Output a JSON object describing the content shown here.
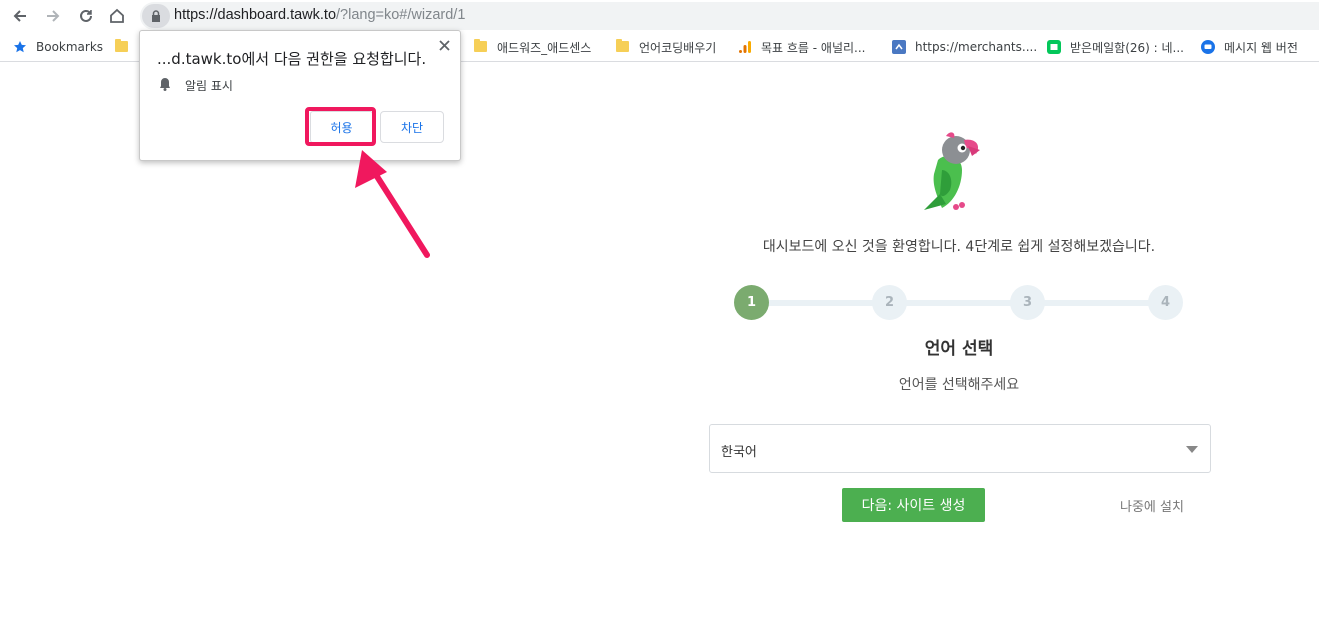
{
  "browser": {
    "url_host": "https://dashboard.tawk.to",
    "url_path": "/?lang=ko#/wizard/1",
    "bookmarks": [
      {
        "label": "Bookmarks",
        "icon": "star-icon"
      },
      {
        "label": "애드워즈_애드센스",
        "icon": "folder-icon"
      },
      {
        "label": "언어코딩배우기",
        "icon": "folder-icon"
      },
      {
        "label": "목표 흐름 - 애널리...",
        "icon": "analytics-icon"
      },
      {
        "label": "https://merchants....",
        "icon": "merchant-icon"
      },
      {
        "label": "받은메일함(26) : 네...",
        "icon": "naver-mail-icon"
      },
      {
        "label": "메시지 웹 버전",
        "icon": "messages-icon"
      }
    ]
  },
  "permission_popup": {
    "title": "...d.tawk.to에서 다음 권한을 요청합니다.",
    "permission": "알림 표시",
    "allow_label": "허용",
    "block_label": "차단"
  },
  "wizard": {
    "welcome": "대시보드에 오신 것을 환영합니다. 4단계로 쉽게 설정해보겠습니다.",
    "steps": [
      "1",
      "2",
      "3",
      "4"
    ],
    "active_step": 1,
    "title": "언어 선택",
    "subtitle": "언어를 선택해주세요",
    "language_value": "한국어",
    "next_label": "다음: 사이트 생성",
    "later_label": "나중에 설치"
  },
  "colors": {
    "accent_green": "#4caf50",
    "step_active": "#7bab6f",
    "highlight_pink": "#f0185e"
  }
}
